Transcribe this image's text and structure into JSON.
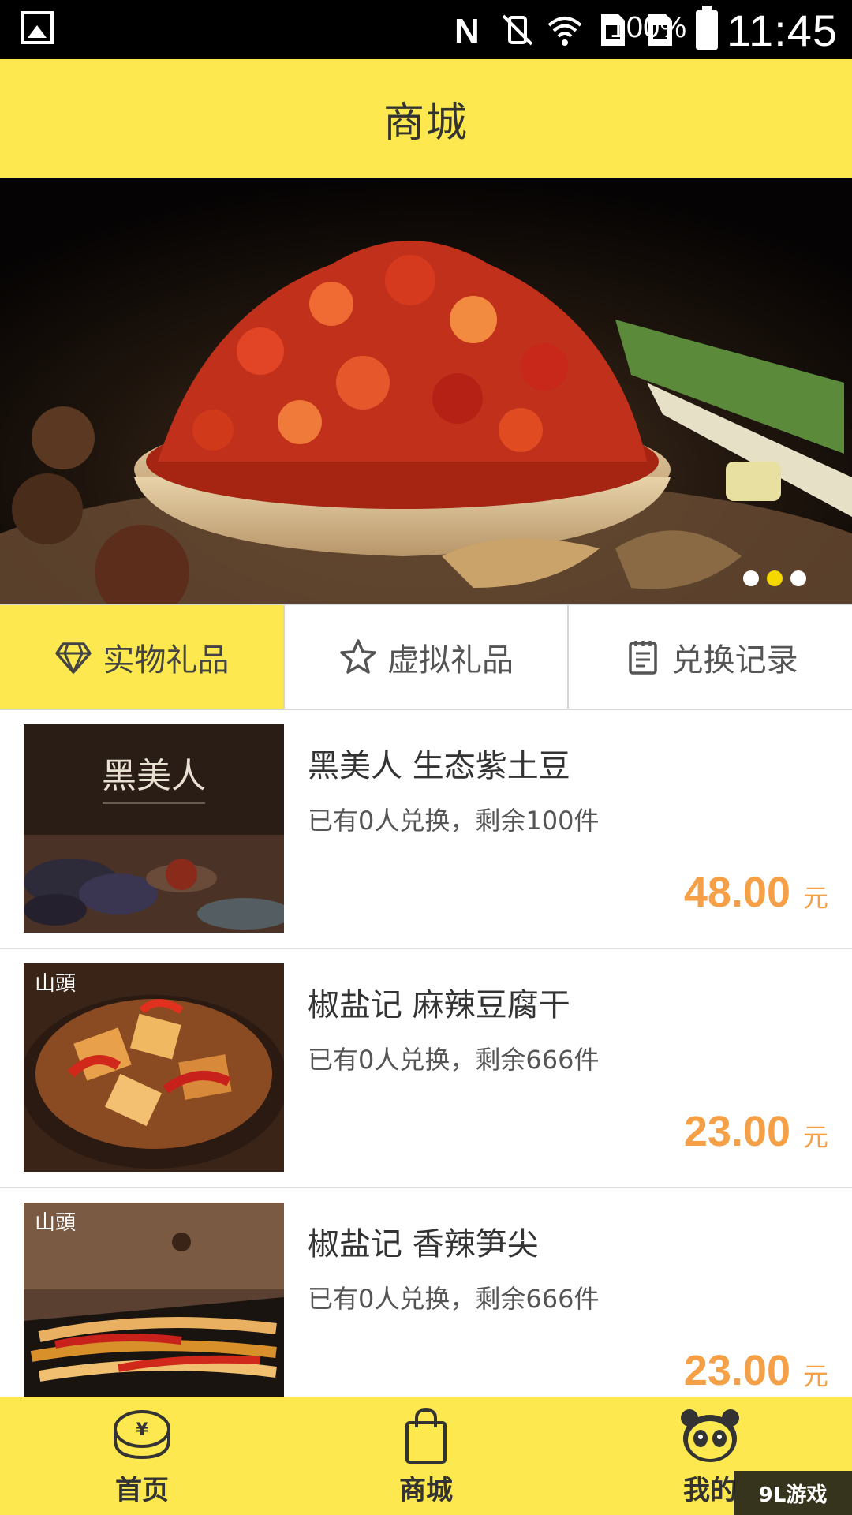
{
  "status_bar": {
    "battery": "100%",
    "time": "11:45"
  },
  "header": {
    "title": "商城"
  },
  "banner": {
    "slide_count": 3,
    "active_slide": 2
  },
  "tabs": [
    {
      "label": "实物礼品",
      "icon": "diamond-icon",
      "active": true
    },
    {
      "label": "虚拟礼品",
      "icon": "star-icon",
      "active": false
    },
    {
      "label": "兑换记录",
      "icon": "clipboard-icon",
      "active": false
    }
  ],
  "products": [
    {
      "name": "黑美人 生态紫土豆",
      "stock": "已有0人兑换，剩余100件",
      "price": "48.00",
      "unit": "元",
      "thumb_text": "黑美人"
    },
    {
      "name": "椒盐记 麻辣豆腐干",
      "stock": "已有0人兑换，剩余666件",
      "price": "23.00",
      "unit": "元",
      "thumb_text": "山頭"
    },
    {
      "name": "椒盐记 香辣笋尖",
      "stock": "已有0人兑换，剩余666件",
      "price": "23.00",
      "unit": "元",
      "thumb_text": "山頭"
    }
  ],
  "bottom_nav": [
    {
      "label": "首页",
      "icon": "coin-icon"
    },
    {
      "label": "商城",
      "icon": "shopping-bag-icon"
    },
    {
      "label": "我的",
      "icon": "panda-icon"
    }
  ],
  "watermark": "9L游戏",
  "colors": {
    "accent_yellow": "#fde94f",
    "price_orange": "#f5a046",
    "active_dot": "#f5d800"
  }
}
